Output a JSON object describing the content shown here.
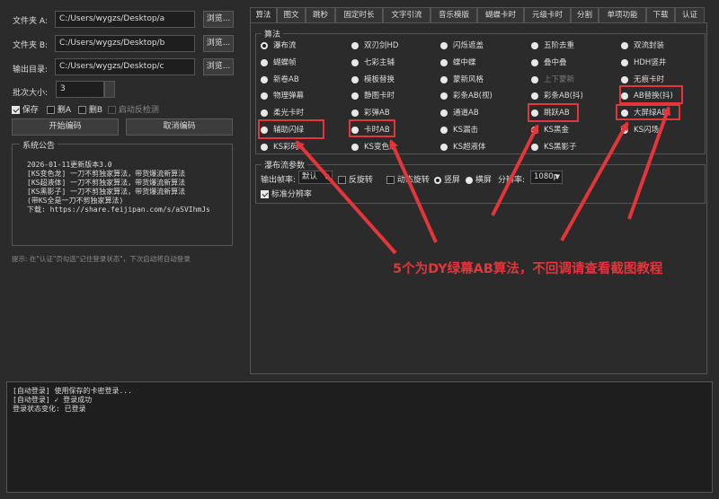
{
  "left": {
    "folder_a_label": "文件夹 A:",
    "folder_a_value": "C:/Users/wygzs/Desktop/a",
    "folder_b_label": "文件夹 B:",
    "folder_b_value": "C:/Users/wygzs/Desktop/b",
    "output_label": "输出目录:",
    "output_value": "C:/Users/wygzs/Desktop/c",
    "browse_label": "浏览...",
    "batch_label": "批次大小:",
    "batch_value": "3",
    "check_save": "保存",
    "check_del_a": "删A",
    "check_del_b": "删B",
    "check_detect": "启动反检测",
    "start_button": "开始编码",
    "cancel_button": "取消编码",
    "notice_title": "系统公告",
    "notice_lines": [
      "2026-01-11更新版本3.0",
      "[KS变色龙]  一刀不剪独家算法，带货爆流新算法",
      "[KS超液体]  一刀不剪独家算法，带货爆流新算法",
      "[KS黑影子]  一刀不剪独家算法，带货爆流新算法",
      "(带KS全是一刀不剪独家算法)",
      "下载: https://share.feijipan.com/s/aSVIhmJs"
    ],
    "hint": "提示: 在\"认证\"页勾选\"记住登录状态\"，下次启动将自动登录"
  },
  "tabs": [
    "算法",
    "图文",
    "跳秒",
    "固定时长",
    "文字引流",
    "音乐模版",
    "蝴蝶卡时",
    "元级卡时",
    "分割",
    "单项功能",
    "下载",
    "认证"
  ],
  "algo": {
    "group_title": "算法",
    "options": [
      [
        "瀑布流",
        "双刃剑HD",
        "闪烁遮盖",
        "五阶去重",
        "双流封装"
      ],
      [
        "蝴蝶帧",
        "七彩主辅",
        "蝶中蝶",
        "叠中叠",
        "HDH竖井"
      ],
      [
        "新卷AB",
        "模板替换",
        "蒙新风格",
        "上下蒙新",
        "无痕卡时"
      ],
      [
        "物理弹幕",
        "静图卡时",
        "彩条AB(视)",
        "彩条AB(抖)",
        "AB替换(抖)"
      ],
      [
        "柔光卡时",
        "彩弹AB",
        "通道AB",
        "跳跃AB",
        "大屏绿AB"
      ],
      [
        "辅助闪绿",
        "卡时AB",
        "KS漏击",
        "KS黑金",
        "KS闪场"
      ],
      [
        "KS彩码",
        "KS变色龙",
        "KS超液体",
        "KS黑影子",
        ""
      ]
    ]
  },
  "waterfall": {
    "group_title": "瀑布流参数",
    "fps_label": "输出帧率:",
    "fps_value": "默认",
    "reverse_label": "反旋转",
    "dynamic_label": "动态旋转",
    "portrait_label": "竖屏",
    "landscape_label": "横屏",
    "resolution_label": "分辨率:",
    "resolution_value": "1080p",
    "standard_res_label": "标准分辨率"
  },
  "annotation": {
    "text": "5个为DY绿幕AB算法，不回调请查看截图教程",
    "color": "#e3353a"
  },
  "log": {
    "lines": [
      "[自动登录] 使用保存的卡密登录...",
      "[自动登录] ✓ 登录成功",
      "登录状态变化: 已登录"
    ]
  }
}
